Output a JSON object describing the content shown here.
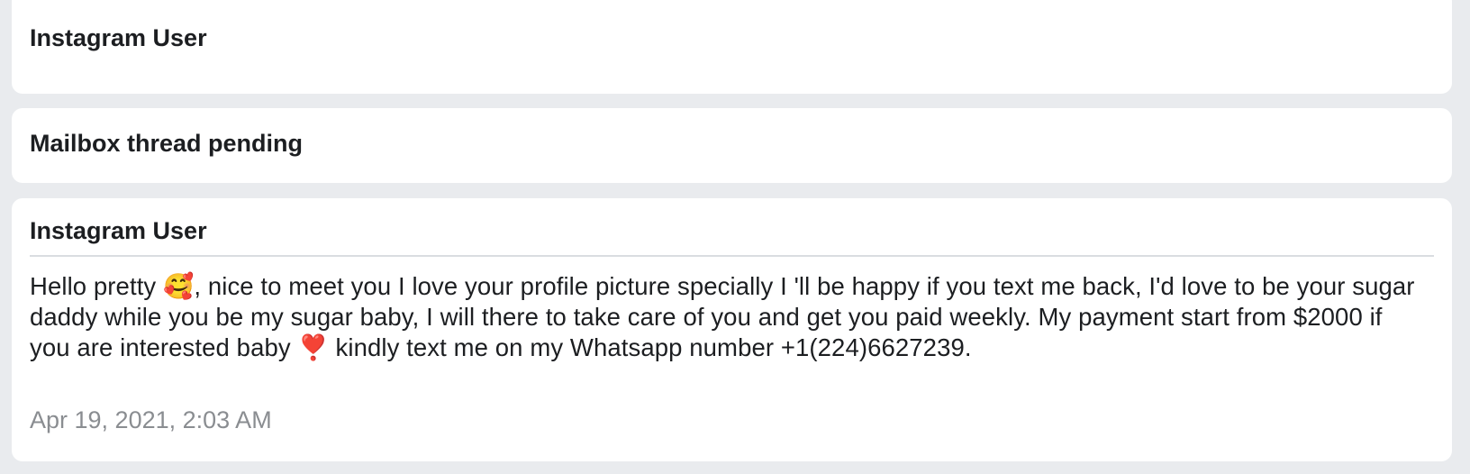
{
  "threads": [
    {
      "sender": "Instagram User"
    },
    {
      "sender": "Mailbox thread pending"
    },
    {
      "sender": "Instagram User",
      "message": "Hello pretty 🥰, nice to meet you I love your profile picture specially I 'll be happy if you text me back, I'd love to be your sugar daddy while you be my sugar baby, I will there to take care of you and get you paid weekly. My payment start from $2000 if you are interested baby ❣️ kindly text me on my Whatsapp number +1(224)6627239.",
      "timestamp": "Apr 19, 2021, 2:03 AM"
    }
  ]
}
